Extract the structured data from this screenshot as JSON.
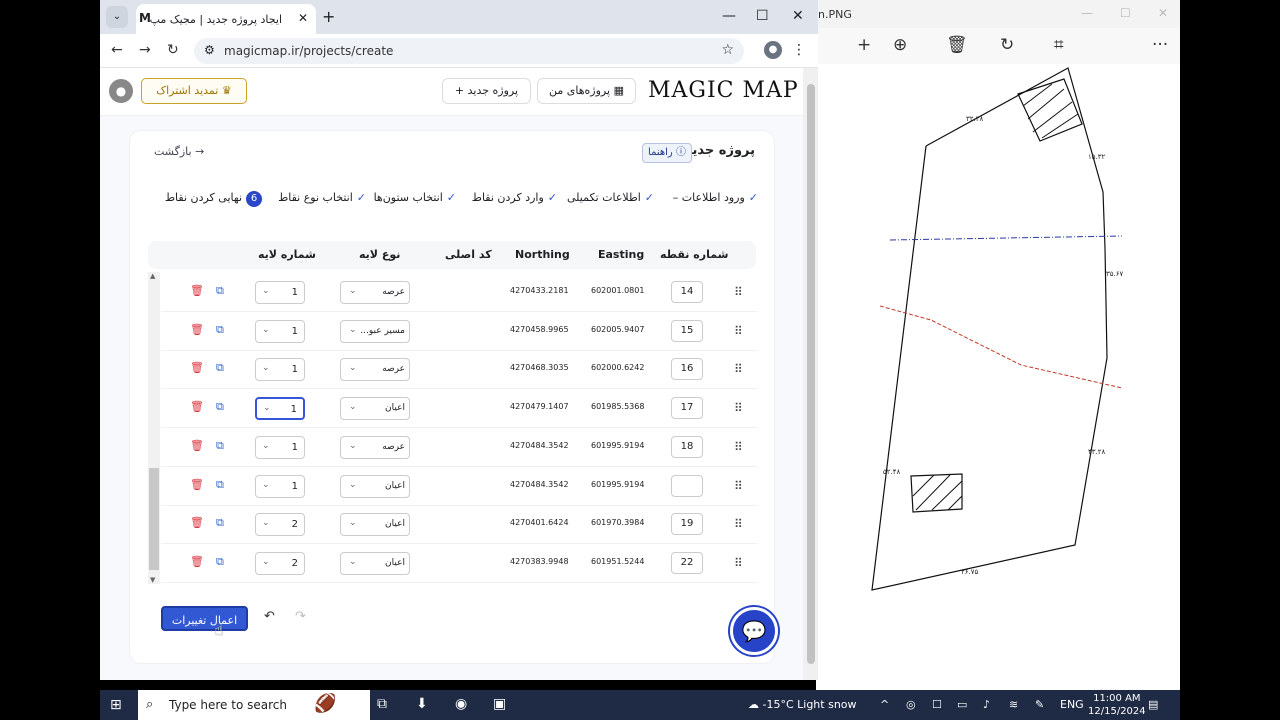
{
  "photos": {
    "title": "n.PNG",
    "tool_icons": [
      "add-icon",
      "zoom-in-icon",
      "delete-icon",
      "rotate-icon",
      "crop-icon",
      "more-icon"
    ],
    "tools": [
      "+",
      "⊕",
      "🗑",
      "↻",
      "⌗",
      "···"
    ]
  },
  "browser": {
    "tab_title": "ایجاد پروژه جدید | مجیک مپ",
    "tab_favicon": "M",
    "url": "magicmap.ir/projects/create"
  },
  "app": {
    "logo": "MAGIC MAP",
    "my_projects": "پروژه‌های من",
    "new_project": "+ پروژه جدید",
    "renew": "تمدید اشتراک"
  },
  "card": {
    "title": "پروژه جدید",
    "help": "راهنما",
    "back": "بازگشت",
    "steps": [
      {
        "label": "ورود اطلاعات",
        "mark": "✓"
      },
      {
        "label": "اطلاعات تکمیلی",
        "mark": "✓"
      },
      {
        "label": "وارد کردن نقاط",
        "mark": "✓"
      },
      {
        "label": "انتخاب ستون‌ها",
        "mark": "✓"
      },
      {
        "label": "انتخاب نوع نقاط",
        "mark": "✓"
      },
      {
        "label": "نهایی کردن نقاط",
        "mark": "6"
      }
    ],
    "columns": {
      "point_no": "شماره نقطه",
      "easting": "Easting",
      "northing": "Northing",
      "orig_code": "کد اصلی",
      "layer_type": "نوع لایه",
      "layer_no": "شماره لایه"
    },
    "rows": [
      {
        "no": "14",
        "e": "602001.0801",
        "n": "4270433.2181",
        "type": "عرصه",
        "layer": "1"
      },
      {
        "no": "15",
        "e": "602005.9407",
        "n": "4270458.9965",
        "type": "مسیر عبو...",
        "layer": "1"
      },
      {
        "no": "16",
        "e": "602000.6242",
        "n": "4270468.3035",
        "type": "عرصه",
        "layer": "1"
      },
      {
        "no": "17",
        "e": "601985.5368",
        "n": "4270479.1407",
        "type": "اعیان",
        "layer": "1"
      },
      {
        "no": "18",
        "e": "601995.9194",
        "n": "4270484.3542",
        "type": "عرصه",
        "layer": "1"
      },
      {
        "no": "",
        "e": "601995.9194",
        "n": "4270484.3542",
        "type": "اعیان",
        "layer": "1"
      },
      {
        "no": "19",
        "e": "601970.3984",
        "n": "4270401.6424",
        "type": "اعیان",
        "layer": "2"
      },
      {
        "no": "22",
        "e": "601951.5244",
        "n": "4270383.9948",
        "type": "اعیان",
        "layer": "2"
      }
    ],
    "apply": "اعمال تغییرات"
  },
  "taskbar": {
    "search_placeholder": "Type here to search",
    "weather": "-15°C  Light snow",
    "lang": "ENG",
    "time": "11:00 AM",
    "date": "12/15/2024"
  }
}
